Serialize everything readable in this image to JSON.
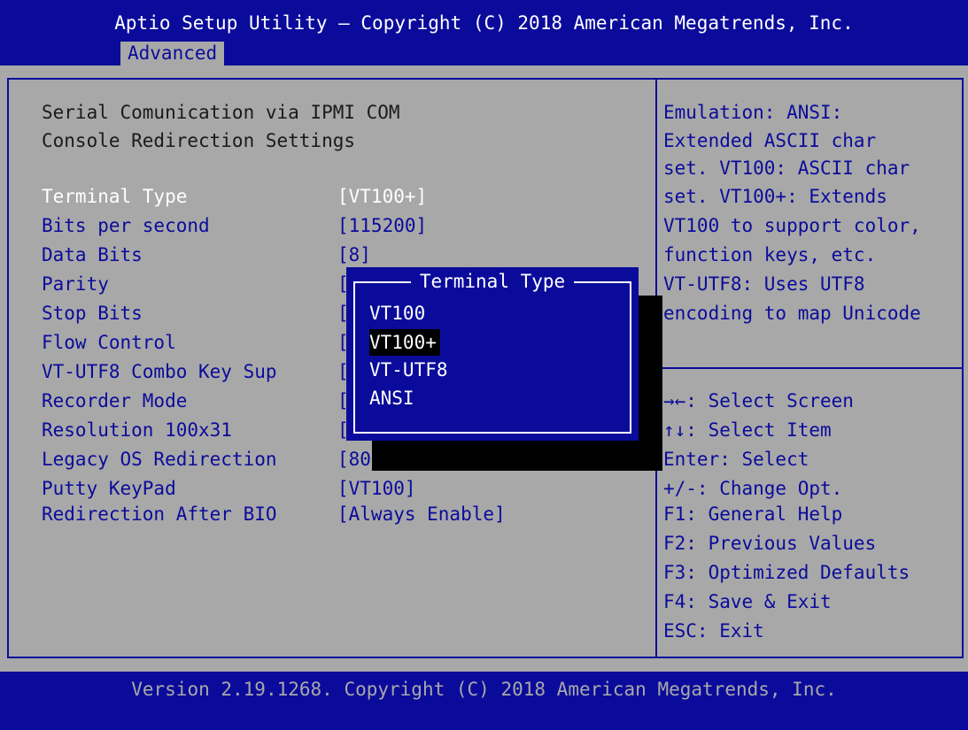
{
  "header": {
    "title": "Aptio Setup Utility – Copyright (C) 2018 American Megatrends, Inc.",
    "tab": "Advanced"
  },
  "main": {
    "title_line1": "Serial Comunication via IPMI COM",
    "title_line2": "Console Redirection Settings",
    "settings": [
      {
        "label": "Terminal Type",
        "value": "[VT100+]"
      },
      {
        "label": "Bits per second",
        "value": "[115200]"
      },
      {
        "label": "Data Bits",
        "value": "[8]"
      },
      {
        "label": "Parity",
        "value": "["
      },
      {
        "label": "Stop Bits",
        "value": "["
      },
      {
        "label": "Flow Control",
        "value": "["
      },
      {
        "label": "VT-UTF8 Combo Key Sup",
        "value": "["
      },
      {
        "label": "Recorder Mode",
        "value": "["
      },
      {
        "label": "Resolution 100x31",
        "value": "["
      },
      {
        "label": "Legacy OS Redirection",
        "value": "[80"
      },
      {
        "label": "Putty KeyPad",
        "value": "[VT100]"
      },
      {
        "label": "Redirection After BIO",
        "value": "[Always Enable]"
      }
    ]
  },
  "popup": {
    "title": "Terminal Type",
    "options": [
      "VT100",
      "VT100+",
      "VT-UTF8",
      "ANSI"
    ],
    "selected": "VT100+"
  },
  "help": {
    "lines": [
      "Emulation: ANSI:",
      "Extended ASCII char",
      "set. VT100: ASCII char",
      "set. VT100+: Extends",
      "VT100 to support color,",
      "function keys, etc.",
      "VT-UTF8: Uses UTF8",
      "encoding to map Unicode"
    ]
  },
  "keys": [
    "→←: Select Screen",
    "↑↓: Select Item",
    "Enter: Select",
    "+/-: Change Opt.",
    "F1: General Help",
    "F2: Previous Values",
    "F3: Optimized Defaults",
    "F4: Save & Exit",
    "ESC: Exit"
  ],
  "footer": {
    "text": "Version 2.19.1268. Copyright (C) 2018 American Megatrends, Inc."
  },
  "colors": {
    "bios_blue": "#0b0b9b",
    "background_gray": "#a8a8a8",
    "highlight": "#ffffff",
    "shadow": "#000000"
  }
}
